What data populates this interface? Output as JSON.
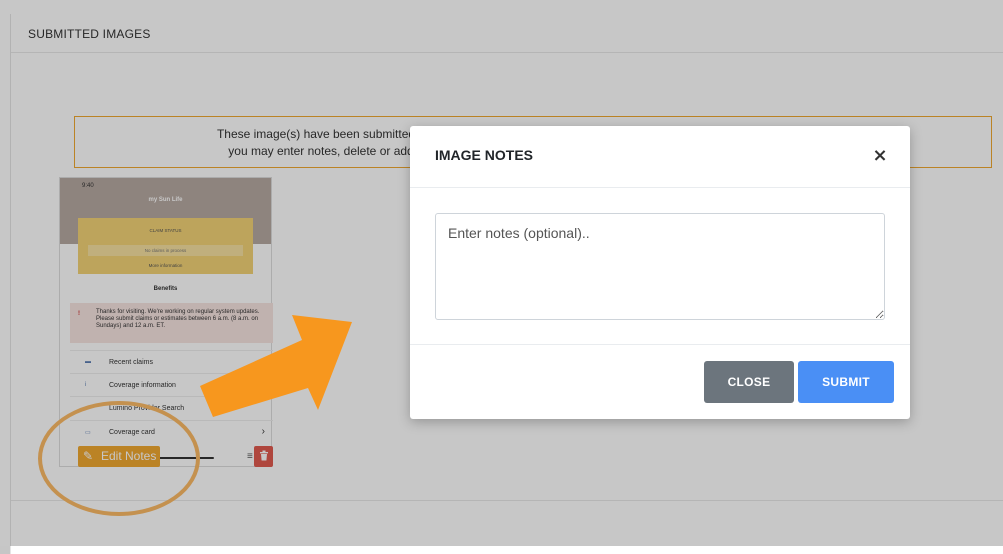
{
  "panel": {
    "title": "SUBMITTED IMAGES",
    "notice_line1": "These image(s) have been submitted a",
    "notice_line2": "you may enter notes, delete or add"
  },
  "thumbnail": {
    "time": "9:40",
    "brand": "my Sun Life",
    "card_title": "CLAIM STATUS",
    "card_box": "No claims in process",
    "card_more": "More information",
    "benefits": "Benefits",
    "alert": "Thanks for visiting. We're working on regular system updates. Please submit claims or estimates between 6 a.m. (8 a.m. on Sundays) and 12 a.m. ET.",
    "rows": [
      {
        "icon": "claims-icon",
        "label": "Recent claims"
      },
      {
        "icon": "info-icon",
        "label": "Coverage information"
      },
      {
        "icon": "search-icon",
        "label": "Lumino Provider Search"
      },
      {
        "icon": "card-icon",
        "label": "Coverage card"
      }
    ]
  },
  "actions": {
    "edit_notes": "Edit Notes"
  },
  "modal": {
    "title": "IMAGE NOTES",
    "close_x": "×",
    "notes_placeholder": "Enter notes (optional)..",
    "close_label": "CLOSE",
    "submit_label": "SUBMIT"
  },
  "colors": {
    "accent_orange": "#f0a830",
    "arrow_orange": "#f7971e",
    "annotation_ring": "#c4914f",
    "submit_blue": "#4a8ff5",
    "close_gray": "#6c757d",
    "delete_red": "#e05a4f"
  }
}
